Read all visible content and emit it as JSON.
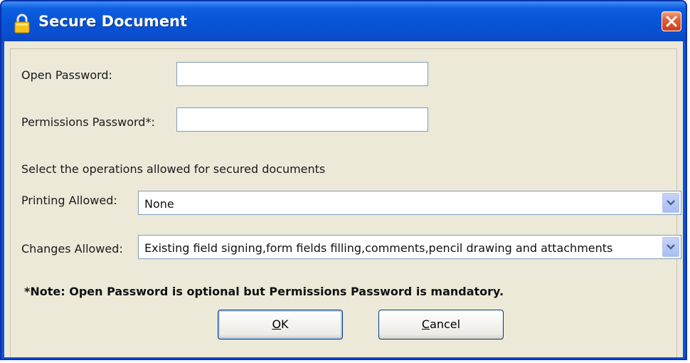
{
  "window": {
    "title": "Secure Document",
    "icon": "lock-icon",
    "close_icon": "close-icon"
  },
  "form": {
    "open_password": {
      "label": "Open Password:",
      "value": ""
    },
    "permissions_password": {
      "label": "Permissions Password*:",
      "value": ""
    },
    "operations_heading": "Select the operations allowed for secured documents",
    "printing": {
      "label": "Printing Allowed:",
      "selected": "None"
    },
    "changes": {
      "label": "Changes Allowed:",
      "selected": "Existing field signing,form fields filling,comments,pencil drawing and attachments"
    },
    "note": "*Note: Open Password is optional but Permissions Password is mandatory."
  },
  "buttons": {
    "ok": {
      "mnemonic": "O",
      "rest": "K"
    },
    "cancel": {
      "mnemonic": "C",
      "rest": "ancel"
    }
  },
  "colors": {
    "titlebar": "#0553d6",
    "client": "#ece9d8",
    "close": "#e05f3c",
    "input_border": "#7f9db9"
  }
}
